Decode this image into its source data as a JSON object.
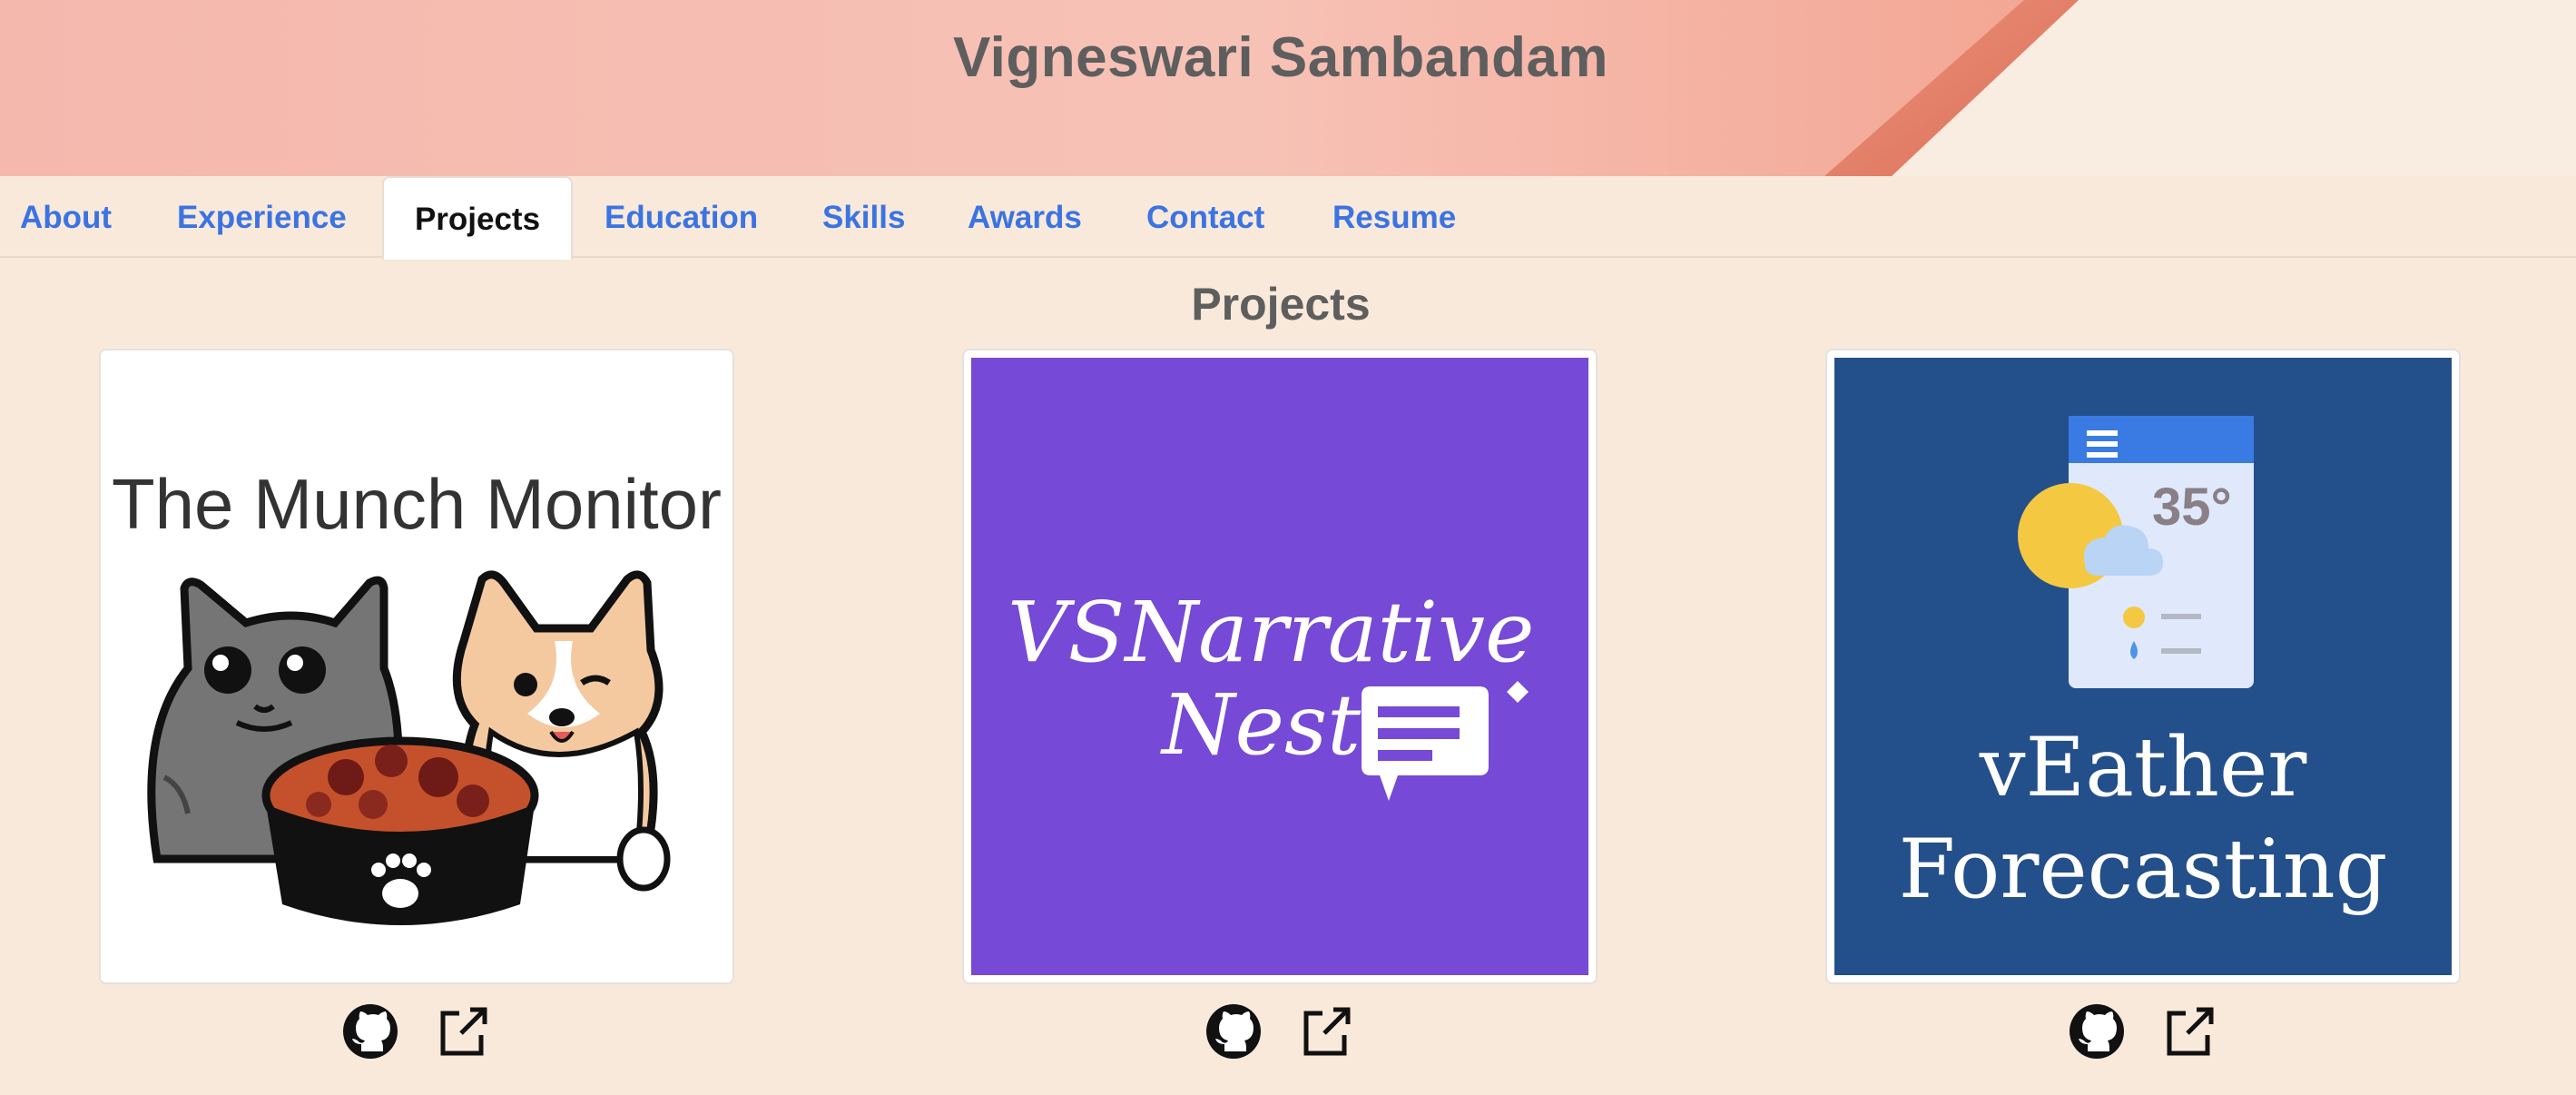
{
  "header": {
    "title": "Vigneswari Sambandam",
    "colors": {
      "pink": "#f5b3ab",
      "peach": "#f9e9dc",
      "accent_stripe": "#e07860"
    }
  },
  "nav": {
    "active_tab": "Projects",
    "tabs": [
      {
        "label": "About"
      },
      {
        "label": "Experience"
      },
      {
        "label": "Projects"
      },
      {
        "label": "Education"
      },
      {
        "label": "Skills"
      },
      {
        "label": "Awards"
      },
      {
        "label": "Contact"
      },
      {
        "label": "Resume"
      }
    ],
    "colors": {
      "link": "#3b74e2",
      "active_text": "#111111"
    }
  },
  "projects": {
    "heading": "Projects",
    "items": [
      {
        "logo_text": "The Munch Monitor",
        "logo_bg": "#ffffff",
        "icons": [
          "github-icon",
          "external-link-icon"
        ]
      },
      {
        "logo_text_line1": "VSNarrative",
        "logo_text_line2": "Nest",
        "logo_bg": "#7649d6",
        "icons": [
          "github-icon",
          "external-link-icon"
        ]
      },
      {
        "logo_temp": "35°",
        "logo_text_line1": "vEather",
        "logo_text_line2": "Forecasting",
        "logo_bg": "#234f8a",
        "icons": [
          "github-icon",
          "external-link-icon"
        ]
      }
    ]
  },
  "page_background": "#f8e9da"
}
